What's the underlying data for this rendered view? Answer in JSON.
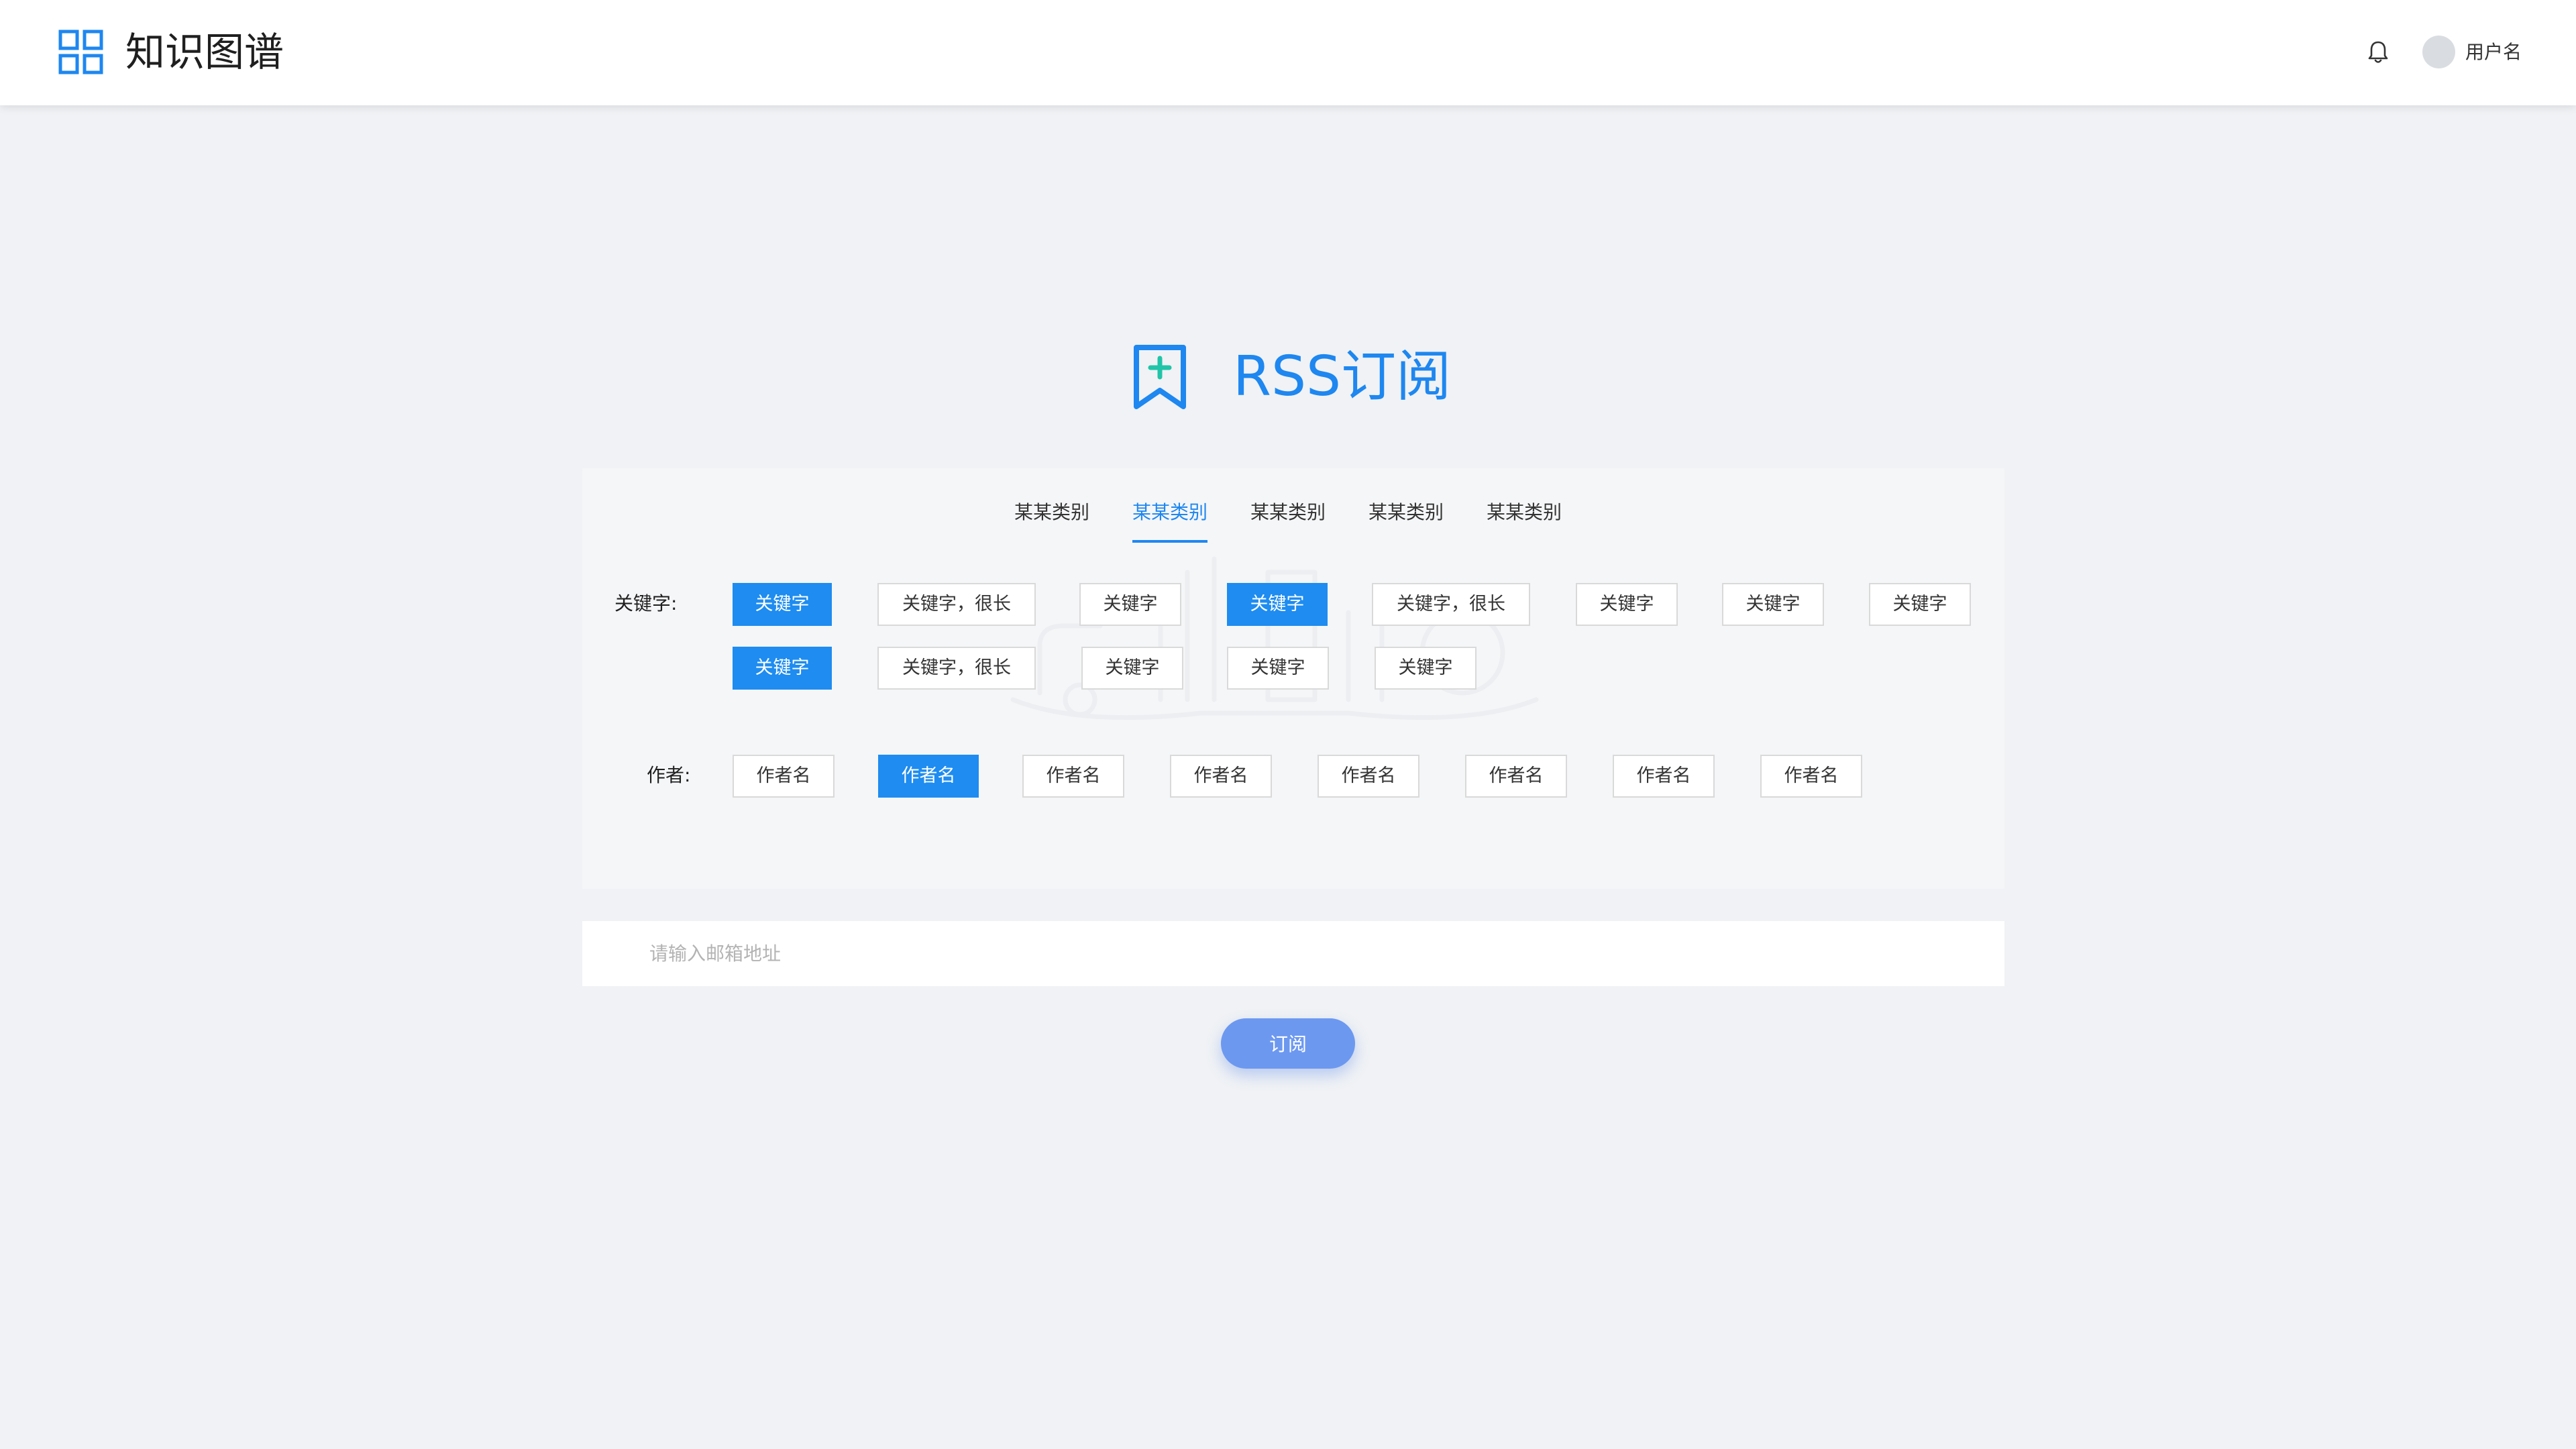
{
  "header": {
    "app_title": "知识图谱",
    "username": "用户名",
    "icons": {
      "logo": "grid-logo-icon",
      "notification": "bell-icon"
    }
  },
  "hero": {
    "title": "RSS订阅",
    "icon": "bookmark-plus-icon"
  },
  "filters": {
    "tabs": [
      {
        "label": "某某类别",
        "active": false
      },
      {
        "label": "某某类别",
        "active": true
      },
      {
        "label": "某某类别",
        "active": false
      },
      {
        "label": "某某类别",
        "active": false
      },
      {
        "label": "某某类别",
        "active": false
      }
    ],
    "keyword_label": "关键字:",
    "keywords": [
      {
        "label": "关键字",
        "selected": true
      },
      {
        "label": "关键字，很长",
        "selected": false
      },
      {
        "label": "关键字",
        "selected": false
      },
      {
        "label": "关键字",
        "selected": true
      },
      {
        "label": "关键字，很长",
        "selected": false
      },
      {
        "label": "关键字",
        "selected": false
      },
      {
        "label": "关键字",
        "selected": false
      },
      {
        "label": "关键字",
        "selected": false
      },
      {
        "label": "关键字",
        "selected": true
      },
      {
        "label": "关键字，很长",
        "selected": false
      },
      {
        "label": "关键字",
        "selected": false
      },
      {
        "label": "关键字",
        "selected": false
      },
      {
        "label": "关键字",
        "selected": false
      }
    ],
    "author_label": "作者:",
    "authors": [
      {
        "label": "作者名",
        "selected": false
      },
      {
        "label": "作者名",
        "selected": true
      },
      {
        "label": "作者名",
        "selected": false
      },
      {
        "label": "作者名",
        "selected": false
      },
      {
        "label": "作者名",
        "selected": false
      },
      {
        "label": "作者名",
        "selected": false
      },
      {
        "label": "作者名",
        "selected": false
      },
      {
        "label": "作者名",
        "selected": false
      }
    ]
  },
  "subscribe": {
    "email_placeholder": "请输入邮箱地址",
    "email_value": "",
    "button_label": "订阅"
  },
  "colors": {
    "accent": "#1e87f0",
    "selected_chip": "#1e8cf0",
    "subscribe_button": "#6c98f0",
    "page_background": "#f0f2f5",
    "panel_background": "#f5f6f8"
  }
}
